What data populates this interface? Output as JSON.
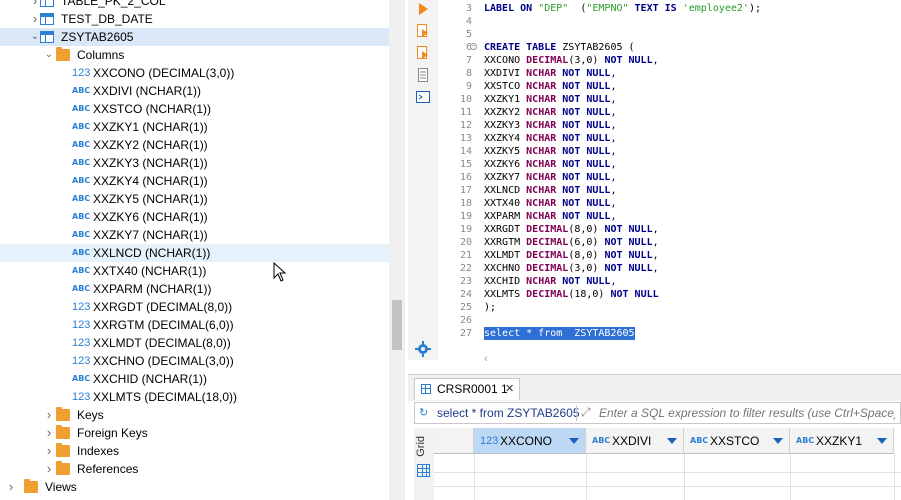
{
  "tree": {
    "items": [
      {
        "label": "TABLE_PK_2_COL",
        "kind": "table",
        "level": 1,
        "state": "collapsed"
      },
      {
        "label": "TEST_DB_DATE",
        "kind": "table",
        "level": 1,
        "state": "collapsed"
      },
      {
        "label": "ZSYTAB2605",
        "kind": "table",
        "level": 1,
        "state": "expanded",
        "selected": true
      },
      {
        "label": "Columns",
        "kind": "folder",
        "level": 2,
        "state": "expanded"
      },
      {
        "label": "XXCONO (DECIMAL(3,0))",
        "kind": "num",
        "level": 3
      },
      {
        "label": "XXDIVI (NCHAR(1))",
        "kind": "abc",
        "level": 3
      },
      {
        "label": "XXSTCO (NCHAR(1))",
        "kind": "abc",
        "level": 3
      },
      {
        "label": "XXZKY1 (NCHAR(1))",
        "kind": "abc",
        "level": 3
      },
      {
        "label": "XXZKY2 (NCHAR(1))",
        "kind": "abc",
        "level": 3
      },
      {
        "label": "XXZKY3 (NCHAR(1))",
        "kind": "abc",
        "level": 3
      },
      {
        "label": "XXZKY4 (NCHAR(1))",
        "kind": "abc",
        "level": 3
      },
      {
        "label": "XXZKY5 (NCHAR(1))",
        "kind": "abc",
        "level": 3
      },
      {
        "label": "XXZKY6 (NCHAR(1))",
        "kind": "abc",
        "level": 3
      },
      {
        "label": "XXZKY7 (NCHAR(1))",
        "kind": "abc",
        "level": 3
      },
      {
        "label": "XXLNCD (NCHAR(1))",
        "kind": "abc",
        "level": 3,
        "hover": true
      },
      {
        "label": "XXTX40 (NCHAR(1))",
        "kind": "abc",
        "level": 3
      },
      {
        "label": "XXPARM (NCHAR(1))",
        "kind": "abc",
        "level": 3
      },
      {
        "label": "XXRGDT (DECIMAL(8,0))",
        "kind": "num",
        "level": 3
      },
      {
        "label": "XXRGTM (DECIMAL(6,0))",
        "kind": "num",
        "level": 3
      },
      {
        "label": "XXLMDT (DECIMAL(8,0))",
        "kind": "num",
        "level": 3
      },
      {
        "label": "XXCHNO (DECIMAL(3,0))",
        "kind": "num",
        "level": 3
      },
      {
        "label": "XXCHID (NCHAR(1))",
        "kind": "abc",
        "level": 3
      },
      {
        "label": "XXLMTS (DECIMAL(18,0))",
        "kind": "num",
        "level": 3
      },
      {
        "label": "Keys",
        "kind": "folder",
        "level": 2,
        "state": "collapsed"
      },
      {
        "label": "Foreign Keys",
        "kind": "folder",
        "level": 2,
        "state": "collapsed"
      },
      {
        "label": "Indexes",
        "kind": "folder",
        "level": 2,
        "state": "collapsed"
      },
      {
        "label": "References",
        "kind": "folder",
        "level": 2,
        "state": "collapsed"
      },
      {
        "label": "Views",
        "kind": "views",
        "level": 0,
        "state": "collapsed"
      }
    ],
    "type_num": "123",
    "type_abc": "ABC"
  },
  "editor": {
    "tools": [
      "run-statement-icon",
      "run-script-icon",
      "explain-plan-icon",
      "script-icon",
      "terminal-icon"
    ],
    "lines": [
      {
        "n": "3",
        "parts": [
          [
            "kw",
            "LABEL ON "
          ],
          [
            "str",
            "\"DEP\""
          ],
          [
            "",
            "  ("
          ],
          [
            "str",
            "\"EMPNO\""
          ],
          [
            "kw",
            " TEXT IS "
          ],
          [
            "str",
            "'employee2'"
          ],
          [
            "",
            ");"
          ]
        ]
      },
      {
        "n": "4",
        "parts": []
      },
      {
        "n": "5",
        "parts": []
      },
      {
        "n": "6",
        "fold": true,
        "parts": [
          [
            "kw",
            "CREATE TABLE "
          ],
          [
            "",
            "ZSYTAB2605 ("
          ]
        ]
      },
      {
        "n": "7",
        "parts": [
          [
            "",
            "XXCONO "
          ],
          [
            "ty",
            "DECIMAL"
          ],
          [
            "",
            "(3,0) "
          ],
          [
            "kw",
            "NOT NULL"
          ],
          [
            "",
            ","
          ]
        ]
      },
      {
        "n": "8",
        "parts": [
          [
            "",
            "XXDIVI "
          ],
          [
            "ty",
            "NCHAR"
          ],
          [
            "kw",
            " NOT NULL"
          ],
          [
            "",
            ","
          ]
        ]
      },
      {
        "n": "9",
        "parts": [
          [
            "",
            "XXSTCO "
          ],
          [
            "ty",
            "NCHAR"
          ],
          [
            "kw",
            " NOT NULL"
          ],
          [
            "",
            ","
          ]
        ]
      },
      {
        "n": "10",
        "parts": [
          [
            "",
            "XXZKY1 "
          ],
          [
            "ty",
            "NCHAR"
          ],
          [
            "kw",
            " NOT NULL"
          ],
          [
            "",
            ","
          ]
        ]
      },
      {
        "n": "11",
        "parts": [
          [
            "",
            "XXZKY2 "
          ],
          [
            "ty",
            "NCHAR"
          ],
          [
            "kw",
            " NOT NULL"
          ],
          [
            "",
            ","
          ]
        ]
      },
      {
        "n": "12",
        "parts": [
          [
            "",
            "XXZKY3 "
          ],
          [
            "ty",
            "NCHAR"
          ],
          [
            "kw",
            " NOT NULL"
          ],
          [
            "",
            ","
          ]
        ]
      },
      {
        "n": "13",
        "parts": [
          [
            "",
            "XXZKY4 "
          ],
          [
            "ty",
            "NCHAR"
          ],
          [
            "kw",
            " NOT NULL"
          ],
          [
            "",
            ","
          ]
        ]
      },
      {
        "n": "14",
        "parts": [
          [
            "",
            "XXZKY5 "
          ],
          [
            "ty",
            "NCHAR"
          ],
          [
            "kw",
            " NOT NULL"
          ],
          [
            "",
            ","
          ]
        ]
      },
      {
        "n": "15",
        "parts": [
          [
            "",
            "XXZKY6 "
          ],
          [
            "ty",
            "NCHAR"
          ],
          [
            "kw",
            " NOT NULL"
          ],
          [
            "",
            ","
          ]
        ]
      },
      {
        "n": "16",
        "parts": [
          [
            "",
            "XXZKY7 "
          ],
          [
            "ty",
            "NCHAR"
          ],
          [
            "kw",
            " NOT NULL"
          ],
          [
            "",
            ","
          ]
        ]
      },
      {
        "n": "17",
        "parts": [
          [
            "",
            "XXLNCD "
          ],
          [
            "ty",
            "NCHAR"
          ],
          [
            "kw",
            " NOT NULL"
          ],
          [
            "",
            ","
          ]
        ]
      },
      {
        "n": "18",
        "parts": [
          [
            "",
            "XXTX40 "
          ],
          [
            "ty",
            "NCHAR"
          ],
          [
            "kw",
            " NOT NULL"
          ],
          [
            "",
            ","
          ]
        ]
      },
      {
        "n": "19",
        "parts": [
          [
            "",
            "XXPARM "
          ],
          [
            "ty",
            "NCHAR"
          ],
          [
            "kw",
            " NOT NULL"
          ],
          [
            "",
            ","
          ]
        ]
      },
      {
        "n": "19",
        "parts": [
          [
            "",
            "XXRGDT "
          ],
          [
            "ty",
            "DECIMAL"
          ],
          [
            "",
            "(8,0) "
          ],
          [
            "kw",
            "NOT NULL"
          ],
          [
            "",
            ","
          ]
        ]
      },
      {
        "n": "20",
        "parts": [
          [
            "",
            "XXRGTM "
          ],
          [
            "ty",
            "DECIMAL"
          ],
          [
            "",
            "(6,0) "
          ],
          [
            "kw",
            "NOT NULL"
          ],
          [
            "",
            ","
          ]
        ]
      },
      {
        "n": "21",
        "parts": [
          [
            "",
            "XXLMDT "
          ],
          [
            "ty",
            "DECIMAL"
          ],
          [
            "",
            "(8,0) "
          ],
          [
            "kw",
            "NOT NULL"
          ],
          [
            "",
            ","
          ]
        ]
      },
      {
        "n": "22",
        "parts": [
          [
            "",
            "XXCHNO "
          ],
          [
            "ty",
            "DECIMAL"
          ],
          [
            "",
            "(3,0) "
          ],
          [
            "kw",
            "NOT NULL"
          ],
          [
            "",
            ","
          ]
        ]
      },
      {
        "n": "23",
        "parts": [
          [
            "",
            "XXCHID "
          ],
          [
            "ty",
            "NCHAR"
          ],
          [
            "kw",
            " NOT NULL"
          ],
          [
            "",
            ","
          ]
        ]
      },
      {
        "n": "24",
        "parts": [
          [
            "",
            "XXLMTS "
          ],
          [
            "ty",
            "DECIMAL"
          ],
          [
            "",
            "(18,0) "
          ],
          [
            "kw",
            "NOT NULL"
          ]
        ]
      },
      {
        "n": "25",
        "parts": [
          [
            "",
            ");"
          ]
        ]
      },
      {
        "n": "26",
        "parts": []
      },
      {
        "n": "27",
        "selected": true,
        "parts": [
          [
            "",
            "select * from  ZSYTAB2605"
          ]
        ]
      }
    ]
  },
  "results": {
    "tab_label": "CRSR0001 1",
    "tab_close": "✕",
    "filter_query": "select * from ZSYTAB2605",
    "filter_placeholder": "Enter a SQL expression to filter results (use Ctrl+Space)",
    "side_label": "Grid",
    "columns": [
      {
        "type": "123",
        "name": "XXCONO",
        "active": true
      },
      {
        "type": "ABC",
        "name": "XXDIVI"
      },
      {
        "type": "ABC",
        "name": "XXSTCO"
      },
      {
        "type": "ABC",
        "name": "XXZKY1"
      }
    ]
  },
  "colors": {
    "accent": "#2d7fd3",
    "selection": "#dae8f7",
    "folder": "#f0a030",
    "keyword": "#00008b",
    "string": "#2a9b2a"
  }
}
